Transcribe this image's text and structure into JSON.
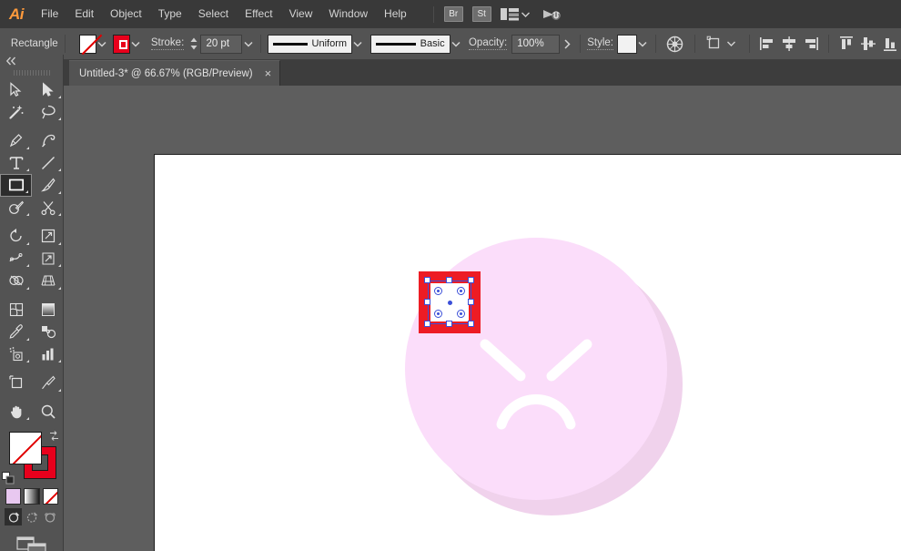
{
  "app": {
    "name": "Adobe Illustrator",
    "logo_text": "Ai",
    "logo_color": "#ff9a3c"
  },
  "menubar": {
    "items": [
      {
        "label": "File"
      },
      {
        "label": "Edit"
      },
      {
        "label": "Object"
      },
      {
        "label": "Type"
      },
      {
        "label": "Select"
      },
      {
        "label": "Effect"
      },
      {
        "label": "View"
      },
      {
        "label": "Window"
      },
      {
        "label": "Help"
      }
    ],
    "bridge_button": "Br",
    "stock_button": "St",
    "arrange_documents_icon": "arrange-documents-icon",
    "workspace_caret_icon": "chevron-down-icon",
    "search_icon": "search-adobe-stock-icon"
  },
  "controlbar": {
    "selection_type": "Rectangle",
    "fill_label": "fill-swatch",
    "fill_value": "None",
    "stroke_swatch_label": "stroke-swatch",
    "stroke_color": "#e8001c",
    "stroke_label": "Stroke:",
    "stroke_weight": "20 pt",
    "width_profile": "Uniform",
    "brush_definition": "Basic",
    "opacity_label": "Opacity:",
    "opacity_value": "100%",
    "style_label": "Style:",
    "recolor_artwork_icon": "recolor-artwork-icon",
    "transform_icon": "transform-icon",
    "align": [
      {
        "name": "align-left-icon"
      },
      {
        "name": "align-horizontal-center-icon"
      },
      {
        "name": "align-right-icon"
      },
      {
        "name": "align-top-icon"
      },
      {
        "name": "align-vertical-center-icon"
      },
      {
        "name": "align-bottom-icon"
      }
    ]
  },
  "document_tab": {
    "title": "Untitled-3* @ 66.67% (RGB/Preview)",
    "close_label": "×",
    "zoom": "66.67%",
    "color_mode": "RGB",
    "view_mode": "Preview",
    "modified": true
  },
  "toolbar": {
    "collapse_icon": "double-chevron-left-icon",
    "tools": [
      {
        "name": "selection-tool",
        "selected": false,
        "flyout": false
      },
      {
        "name": "direct-selection-tool",
        "selected": false,
        "flyout": true
      },
      {
        "name": "magic-wand-tool",
        "selected": false,
        "flyout": false
      },
      {
        "name": "lasso-tool",
        "selected": false,
        "flyout": false
      },
      {
        "name": "pen-tool",
        "selected": false,
        "flyout": true
      },
      {
        "name": "curvature-tool",
        "selected": false,
        "flyout": false
      },
      {
        "name": "type-tool",
        "selected": false,
        "flyout": true
      },
      {
        "name": "line-segment-tool",
        "selected": false,
        "flyout": true
      },
      {
        "name": "rectangle-tool",
        "selected": true,
        "flyout": true
      },
      {
        "name": "paintbrush-tool",
        "selected": false,
        "flyout": true
      },
      {
        "name": "shaper-tool",
        "selected": false,
        "flyout": true
      },
      {
        "name": "scissors-tool",
        "selected": false,
        "flyout": true
      },
      {
        "name": "rotate-tool",
        "selected": false,
        "flyout": true
      },
      {
        "name": "scale-tool",
        "selected": false,
        "flyout": true
      },
      {
        "name": "width-tool",
        "selected": false,
        "flyout": true
      },
      {
        "name": "free-transform-tool",
        "selected": false,
        "flyout": false
      },
      {
        "name": "shape-builder-tool",
        "selected": false,
        "flyout": true
      },
      {
        "name": "perspective-grid-tool",
        "selected": false,
        "flyout": true
      },
      {
        "name": "mesh-tool",
        "selected": false,
        "flyout": false
      },
      {
        "name": "gradient-tool",
        "selected": false,
        "flyout": false
      },
      {
        "name": "eyedropper-tool",
        "selected": false,
        "flyout": true
      },
      {
        "name": "blend-tool",
        "selected": false,
        "flyout": false
      },
      {
        "name": "symbol-sprayer-tool",
        "selected": false,
        "flyout": true
      },
      {
        "name": "column-graph-tool",
        "selected": false,
        "flyout": true
      },
      {
        "name": "artboard-tool",
        "selected": false,
        "flyout": false
      },
      {
        "name": "slice-tool",
        "selected": false,
        "flyout": true
      },
      {
        "name": "hand-tool",
        "selected": false,
        "flyout": true
      },
      {
        "name": "zoom-tool",
        "selected": false,
        "flyout": false
      }
    ],
    "fill_color": "None",
    "stroke_color": "#e8001c",
    "swap_icon": "swap-fill-stroke-icon",
    "default_icon": "default-fill-stroke-icon",
    "color_modes": [
      {
        "name": "color-button",
        "color": "#e8c8f0",
        "selected": false
      },
      {
        "name": "gradient-button",
        "selected": false
      },
      {
        "name": "none-button",
        "selected": false
      }
    ],
    "draw_modes": [
      {
        "name": "draw-normal-button",
        "selected": true
      },
      {
        "name": "draw-behind-button",
        "selected": false
      },
      {
        "name": "draw-inside-button",
        "selected": false
      }
    ],
    "screen_mode": "change-screen-mode-button"
  },
  "canvas": {
    "background_color": "#5e5e5e",
    "artboard_color": "#ffffff",
    "artwork": {
      "emoji": {
        "name": "angry-face-emoji",
        "face_color": "#fbddfa",
        "shadow_color": "#f0d2ec",
        "feature_color": "#ffffff",
        "expression": "angry"
      },
      "selected_shape": {
        "name": "rectangle-shape",
        "fill": "#ffffff",
        "stroke": "#ed1c24",
        "stroke_weight": "20 pt",
        "selected": true,
        "handle_count": 8,
        "corner_widget_count": 4
      }
    }
  }
}
